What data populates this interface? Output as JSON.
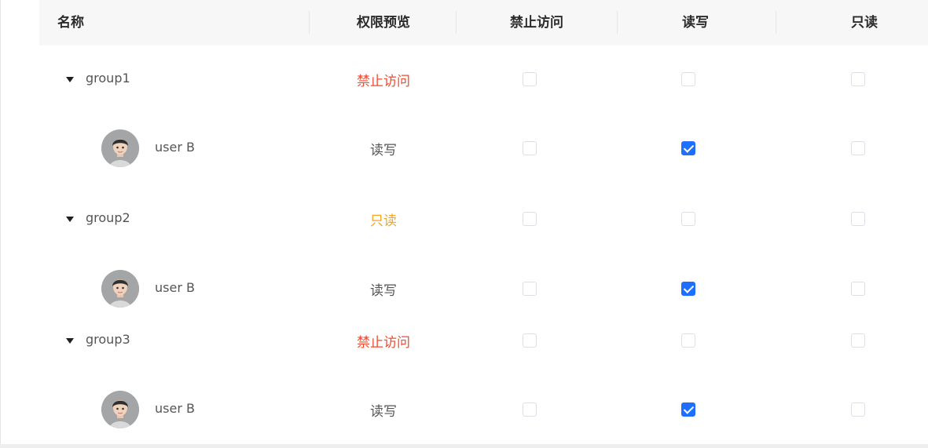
{
  "colors": {
    "deny": "#f04a2f",
    "readonly": "#f5a623",
    "readwrite": "#555555",
    "checkbox_checked": "#1e6fff"
  },
  "header": {
    "columns": [
      "名称",
      "权限预览",
      "禁止访问",
      "读写",
      "只读"
    ]
  },
  "rows": [
    {
      "type": "group",
      "name": "group1",
      "permission": "禁止访问",
      "permission_status": "deny",
      "deny": false,
      "readwrite": false,
      "readonly": false
    },
    {
      "type": "user",
      "name": "user B",
      "avatar": "avatar-icon",
      "permission": "读写",
      "permission_status": "readwrite",
      "deny": false,
      "readwrite": true,
      "readonly": false
    },
    {
      "type": "group",
      "name": "group2",
      "permission": "只读",
      "permission_status": "readonly",
      "deny": false,
      "readwrite": false,
      "readonly": false
    },
    {
      "type": "user",
      "name": "user B",
      "avatar": "avatar-icon",
      "permission": "读写",
      "permission_status": "readwrite",
      "deny": false,
      "readwrite": true,
      "readonly": false
    },
    {
      "type": "group",
      "name": "group3",
      "permission": "禁止访问",
      "permission_status": "deny",
      "deny": false,
      "readwrite": false,
      "readonly": false
    },
    {
      "type": "user",
      "name": "user B",
      "avatar": "avatar-icon",
      "permission": "读写",
      "permission_status": "readwrite",
      "deny": false,
      "readwrite": true,
      "readonly": false
    }
  ]
}
